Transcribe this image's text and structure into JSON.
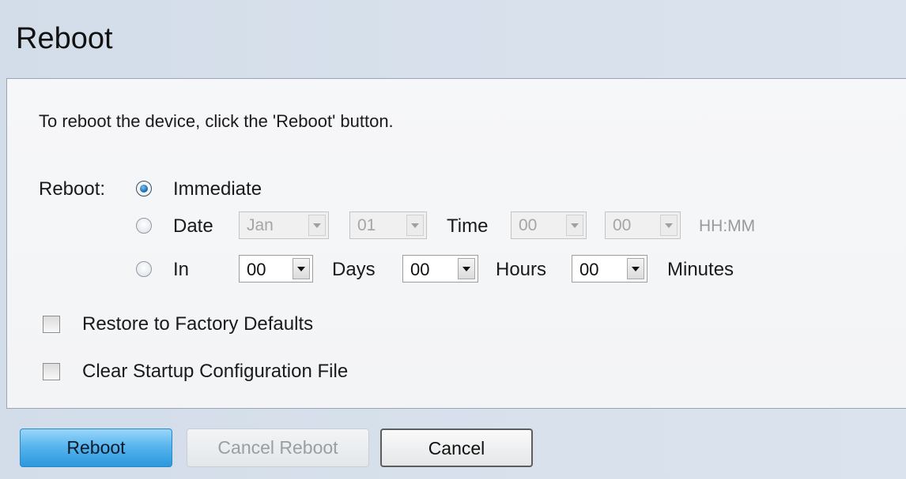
{
  "page_title": "Reboot",
  "intro": "To reboot the device, click the 'Reboot' button.",
  "reboot": {
    "label": "Reboot:",
    "immediate_label": "Immediate",
    "date": {
      "label": "Date",
      "month": "Jan",
      "day": "01",
      "time_label": "Time",
      "hour": "00",
      "minute": "00",
      "format_hint": "HH:MM"
    },
    "in": {
      "label": "In",
      "days": "00",
      "days_label": "Days",
      "hours": "00",
      "hours_label": "Hours",
      "minutes": "00",
      "minutes_label": "Minutes"
    },
    "selected": "Immediate"
  },
  "options": {
    "restore_label": "Restore to Factory Defaults",
    "restore_checked": false,
    "clear_label": "Clear Startup Configuration File",
    "clear_checked": false
  },
  "buttons": {
    "reboot": "Reboot",
    "cancel_reboot": "Cancel Reboot",
    "cancel": "Cancel"
  },
  "colors": {
    "primary_button": "#58b5ee",
    "radio_selected": "#1f6fb1"
  }
}
